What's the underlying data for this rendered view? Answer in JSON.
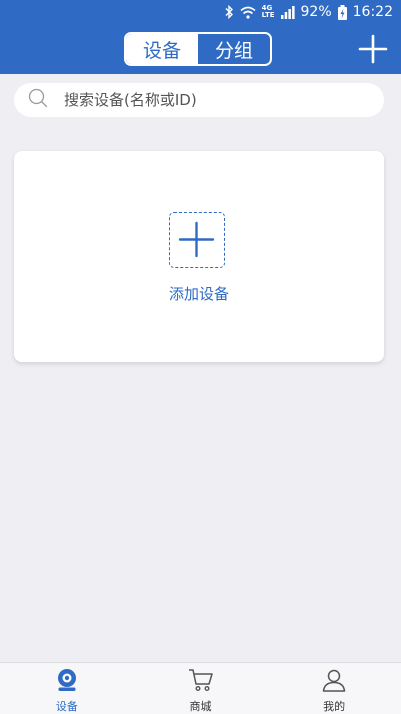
{
  "status_bar": {
    "network_top": "4G",
    "network_bottom": "LTE",
    "battery_percent": "92%",
    "time": "16:22"
  },
  "header": {
    "tabs": [
      {
        "label": "设备",
        "active": true
      },
      {
        "label": "分组",
        "active": false
      }
    ],
    "add_icon": "plus-icon"
  },
  "search": {
    "placeholder": "搜索设备(名称或ID)",
    "value": ""
  },
  "card": {
    "add_label": "添加设备"
  },
  "tabbar": {
    "items": [
      {
        "label": "设备",
        "icon": "camera-icon",
        "active": true
      },
      {
        "label": "商城",
        "icon": "cart-icon",
        "active": false
      },
      {
        "label": "我的",
        "icon": "user-icon",
        "active": false
      }
    ]
  },
  "colors": {
    "brand": "#2f6bc4",
    "background": "#eeeef3",
    "card": "#ffffff"
  }
}
